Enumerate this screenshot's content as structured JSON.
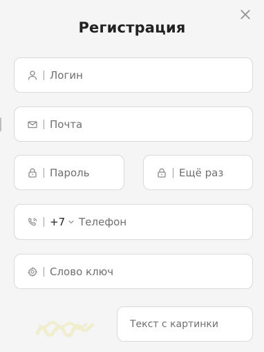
{
  "modal": {
    "title": "Регистрация"
  },
  "fields": {
    "login": {
      "placeholder": "Логин"
    },
    "email": {
      "placeholder": "Почта"
    },
    "password": {
      "placeholder": "Пароль"
    },
    "password_repeat": {
      "placeholder": "Ещё раз"
    },
    "phone": {
      "prefix": "+7",
      "placeholder": "Телефон"
    },
    "keyword": {
      "placeholder": "Слово ключ"
    },
    "captcha_input": {
      "placeholder": "Текст с картинки"
    }
  },
  "icons": {
    "close": "close-icon",
    "user": "user-icon",
    "mail": "mail-icon",
    "lock": "lock-icon",
    "phone": "phone-icon",
    "gear": "gear-icon",
    "chevron": "chevron-down-icon"
  },
  "colors": {
    "background": "#f5f5f5",
    "field_bg": "#ffffff",
    "field_border": "#d9d9d9",
    "placeholder": "#6f6f6f",
    "icon": "#8a8a8a",
    "captcha": "#e7e28a"
  }
}
